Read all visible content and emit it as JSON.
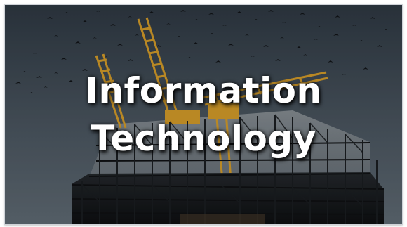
{
  "banner": {
    "title_line1": "Information",
    "title_line2": "Technology"
  },
  "colors": {
    "sky_top": "#2f3a45",
    "sky_bottom": "#55606a",
    "crane": "#d39b2a",
    "scaffold": "#141618",
    "birds": "#111316",
    "title_text": "#ffffff"
  },
  "icons": [
    "construction-building-photo",
    "tower-crane",
    "bird-flock"
  ]
}
